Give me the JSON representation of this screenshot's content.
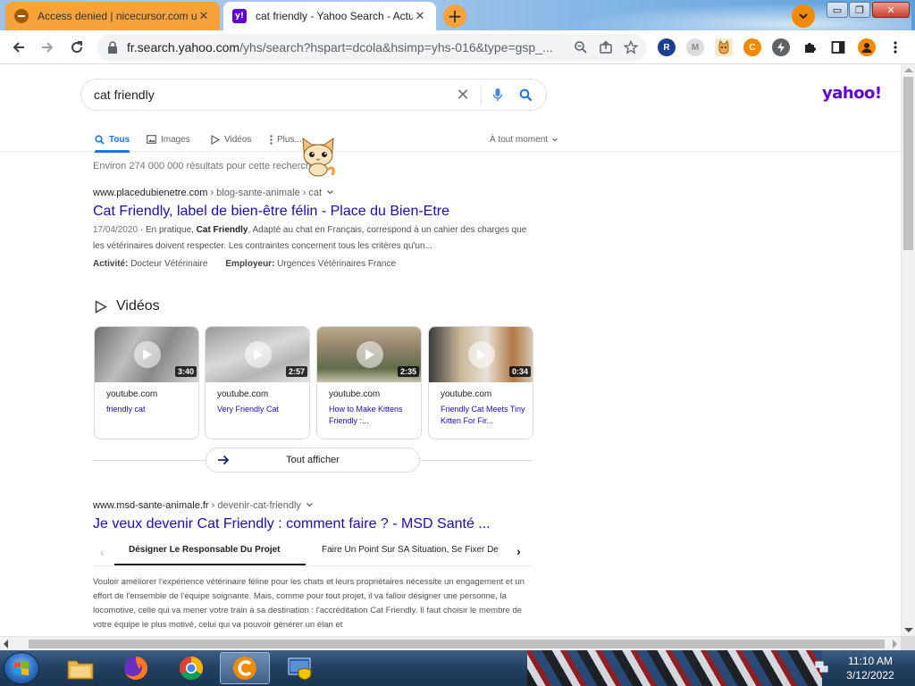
{
  "browser": {
    "tabs": [
      {
        "title": "Access denied | nicecursor.com u",
        "icon": "blocked-icon",
        "active": false,
        "color": "#f8a23c"
      },
      {
        "title": "cat friendly - Yahoo Search - Actu",
        "icon": "yahoo-favicon",
        "active": true
      }
    ],
    "new_tab_label": "+",
    "tab_close": "✕",
    "window_controls": {
      "minimize": "▭",
      "maximize": "❐",
      "close": "✕"
    },
    "url_host": "fr.search.yahoo.com",
    "url_rest": "/yhs/search?hspart=dcola&hsimp=yhs-016&type=gsp_..."
  },
  "search": {
    "query": "cat friendly",
    "logo": "yahoo!",
    "tabs": [
      {
        "label": "Tous",
        "active": true
      },
      {
        "label": "Images",
        "active": false
      },
      {
        "label": "Vidéos",
        "active": false
      },
      {
        "label": "Plus...",
        "active": false
      }
    ],
    "time_filter": "À tout moment",
    "stats": "Environ 274 000 000 résultats pour cette recherche"
  },
  "result1": {
    "host": "www.placedubienetre.com",
    "path": " › blog-sante-animale › cat",
    "title": "Cat Friendly, label de bien-être félin - Place du Bien-Etre",
    "date": "17/04/2020",
    "snippet_a": " · En pratique, ",
    "snippet_bold": "Cat Friendly",
    "snippet_b": ", Adapté au chat en Français, correspond à un cahier des charges que les vétérinaires doivent respecter. Les contraintes concernent tous les critères qu'un...",
    "attr1_label": "Activité:",
    "attr1_value": " Docteur Vétérinaire",
    "attr2_label": "Employeur:",
    "attr2_value": " Urgences Vétérinaires France"
  },
  "videos": {
    "heading": "Vidéos",
    "items": [
      {
        "duration": "3:40",
        "source": "youtube.com",
        "title": "friendly cat"
      },
      {
        "duration": "2:57",
        "source": "youtube.com",
        "title": "Very Friendly Cat"
      },
      {
        "duration": "2:35",
        "source": "youtube.com",
        "title": "How to Make Kittens Friendly :..."
      },
      {
        "duration": "0:34",
        "source": "youtube.com",
        "title": "Friendly Cat Meets Tiny Kitten For Fir..."
      }
    ],
    "show_all": "Tout afficher"
  },
  "result2": {
    "host": "www.msd-sante-animale.fr",
    "path": " › devenir-cat-friendly",
    "title": "Je veux devenir Cat Friendly : comment faire ? - MSD Santé ...",
    "carousel": [
      "Désigner Le Responsable Du Projet",
      "Faire Un Point Sur SA Situation, Se Fixer De"
    ],
    "snippet": "Vouloir améliorer l'expérience vétérinaire féline pour les chats et leurs propriétaires nécessite un engagement et un effort de l'ensemble de l'équipe soignante. Mais, comme pour tout projet, il va falloir désigner une personne, la locomotive, celle qui va mener votre train à sa destination : l'accréditation Cat Friendly. Il faut choisir le membre de votre équipe le plus motivé, celui qui va pouvoir générer un élan et"
  },
  "taskbar": {
    "time": "11:10 AM",
    "date": "3/12/2022"
  },
  "colors": {
    "link": "#1a0dab",
    "accent_blue": "#1a73e8",
    "yahoo_purple": "#6001d2",
    "inactive_tab": "#f8a23c"
  }
}
